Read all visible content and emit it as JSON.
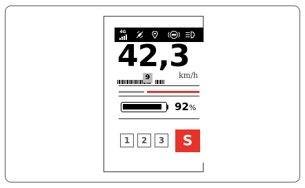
{
  "display": {
    "network": "4G",
    "speed": "42,3",
    "unit": "km/h",
    "gear": "9",
    "battery_percent_value": 92,
    "battery_percent": "92",
    "percent_sign": "%",
    "level_fraction": 0.34,
    "modes": [
      "1",
      "2",
      "3"
    ],
    "active_mode": "S"
  },
  "colors": {
    "accent": "#e8332b",
    "muted": "#999999",
    "foreground": "#000000"
  },
  "icons": [
    "signal-icon",
    "satellite-icon",
    "location-pin-icon",
    "abs-icon",
    "headlight-icon"
  ]
}
